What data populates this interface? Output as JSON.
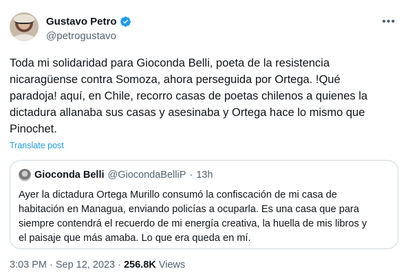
{
  "author": {
    "name": "Gustavo Petro",
    "handle": "@petrogustavo",
    "verified_color": "#1d9bf0"
  },
  "tweet": {
    "text": "Toda mi solidaridad para Gioconda Belli, poeta de la resistencia\nnicaragüense contra Somoza, ahora perseguida por Ortega. !Qué\nparadoja! aquí, en Chile, recorro casas de poetas chilenos a quienes la\ndictadura allanaba sus casas y asesinaba y Ortega hace lo mismo que\nPinochet.",
    "translate_label": "Translate post"
  },
  "quoted": {
    "name": "Gioconda Belli",
    "handle": "@GiocondaBelliP",
    "dot": "·",
    "time": "13h",
    "text": "Ayer la dictadura Ortega Murillo consumó la confiscación de mi casa de\nhabitación en Managua, enviando policías a ocuparla. Es una casa que para\nsiempre contendrá el recuerdo de mi energía creativa, la huella de mis libros y\nel paisaje que más amaba. Lo que era queda en mí."
  },
  "meta": {
    "time": "3:03 PM",
    "sep1": "·",
    "date": "Sep 12, 2023",
    "sep2": "·",
    "views": "256.8K",
    "views_label": "Views"
  },
  "icons": {
    "more": "more-icon",
    "verified": "verified-badge-icon"
  }
}
